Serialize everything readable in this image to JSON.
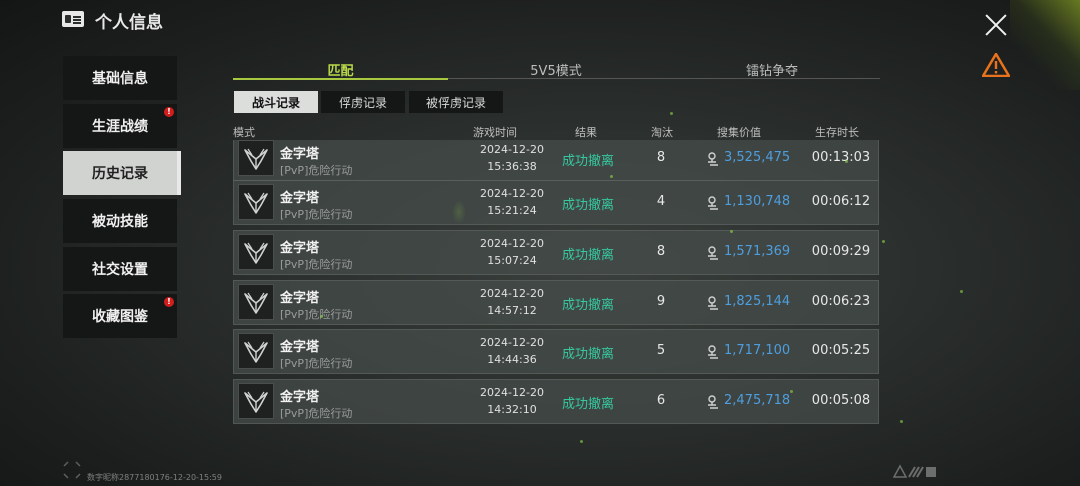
{
  "header": {
    "title": "个人信息"
  },
  "sidebar": {
    "items": [
      {
        "label": "基础信息",
        "active": false,
        "badge": false
      },
      {
        "label": "生涯战绩",
        "active": false,
        "badge": true
      },
      {
        "label": "历史记录",
        "active": true,
        "badge": false
      },
      {
        "label": "被动技能",
        "active": false,
        "badge": false
      },
      {
        "label": "社交设置",
        "active": false,
        "badge": false
      },
      {
        "label": "收藏图鉴",
        "active": false,
        "badge": true
      }
    ],
    "badge_text": "!"
  },
  "top_tabs": [
    {
      "label": "匹配",
      "active": true
    },
    {
      "label": "5V5模式",
      "active": false
    },
    {
      "label": "镭钻争夺",
      "active": false
    }
  ],
  "sub_tabs": [
    {
      "label": "战斗记录",
      "active": true
    },
    {
      "label": "俘虏记录",
      "active": false
    },
    {
      "label": "被俘虏记录",
      "active": false
    }
  ],
  "columns": {
    "mode": "模式",
    "time": "游戏时间",
    "result": "结果",
    "elims": "淘汰",
    "value": "搜集价值",
    "survival": "生存时长"
  },
  "rows": [
    {
      "map": "金字塔",
      "mode": "[PvP]危险行动",
      "date": "2024-12-20",
      "time": "15:36:38",
      "result": "成功撤离",
      "elims": "8",
      "value": "3,525,475",
      "survival": "00:13:03"
    },
    {
      "map": "金字塔",
      "mode": "[PvP]危险行动",
      "date": "2024-12-20",
      "time": "15:21:24",
      "result": "成功撤离",
      "elims": "4",
      "value": "1,130,748",
      "survival": "00:06:12"
    },
    {
      "map": "金字塔",
      "mode": "[PvP]危险行动",
      "date": "2024-12-20",
      "time": "15:07:24",
      "result": "成功撤离",
      "elims": "8",
      "value": "1,571,369",
      "survival": "00:09:29"
    },
    {
      "map": "金字塔",
      "mode": "[PvP]危险行动",
      "date": "2024-12-20",
      "time": "14:57:12",
      "result": "成功撤离",
      "elims": "9",
      "value": "1,825,144",
      "survival": "00:06:23"
    },
    {
      "map": "金字塔",
      "mode": "[PvP]危险行动",
      "date": "2024-12-20",
      "time": "14:44:36",
      "result": "成功撤离",
      "elims": "5",
      "value": "1,717,100",
      "survival": "00:05:25"
    },
    {
      "map": "金字塔",
      "mode": "[PvP]危险行动",
      "date": "2024-12-20",
      "time": "14:32:10",
      "result": "成功撤离",
      "elims": "6",
      "value": "2,475,718",
      "survival": "00:05:08"
    }
  ],
  "footer": {
    "text": "数字昵称2877180176-12-20-15:59"
  },
  "icons": {
    "header": "id-card-icon",
    "close": "close-icon",
    "warning": "warning-icon",
    "map": "winged-emblem-icon",
    "value": "coin-stack-icon"
  },
  "colors": {
    "accent_green": "#b8d84a",
    "result_green": "#36c9a0",
    "value_blue": "#4e9ede",
    "badge_red": "#d21d1d",
    "warning_orange": "#e9731c"
  }
}
